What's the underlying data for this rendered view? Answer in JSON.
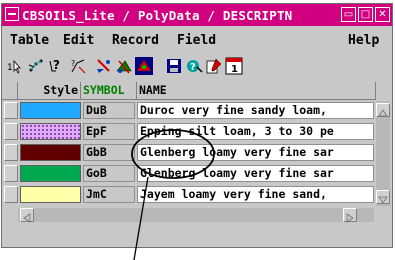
{
  "window": {
    "title": "CBSOILS_Lite / PolyData / DESCRIPTN"
  },
  "menu": {
    "table": "Table",
    "edit": "Edit",
    "record": "Record",
    "field": "Field",
    "help": "Help"
  },
  "toolbar": {
    "icons": [
      "table-view-icon",
      "tree-view-icon",
      "query-icon",
      "chart-icon",
      "select-icon",
      "multi-select-icon",
      "highlight-icon",
      "save-icon",
      "link-icon",
      "edit-record-icon",
      "info-icon"
    ]
  },
  "grid": {
    "columns": {
      "style": "Style",
      "symbol": "SYMBOL",
      "name": "NAME"
    },
    "colors": {
      "symbol_header": "#008000"
    },
    "rows": [
      {
        "color": "#1ea8ff",
        "symbol": "DuB",
        "name": "Duroc very fine sandy loam,"
      },
      {
        "color": "#e8a8ff",
        "symbol": "EpF",
        "name": "Epping silt loam, 3 to 30 pe"
      },
      {
        "color": "#600000",
        "symbol": "GbB",
        "name": "Glenberg loamy very fine sar"
      },
      {
        "color": "#00a850",
        "symbol": "GoB",
        "name": "Glenberg loamy very fine sar"
      },
      {
        "color": "#ffffa8",
        "symbol": "JmC",
        "name": "Jayem loamy very fine sand,"
      }
    ]
  }
}
